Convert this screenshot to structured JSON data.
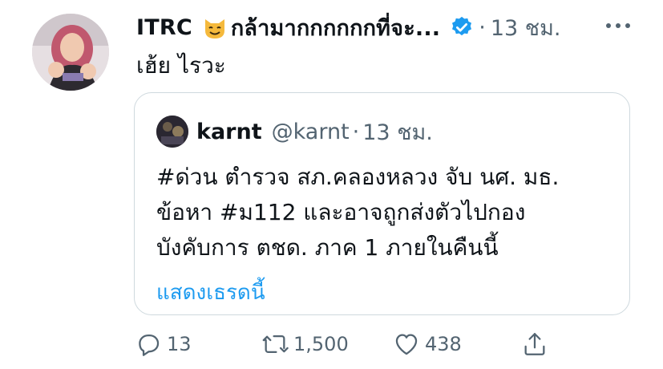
{
  "tweet": {
    "author_name": "ITRC",
    "author_name_suffix": "กล้ามากกกกกกที่จะ...",
    "timestamp": "13 ชม.",
    "dot": "·",
    "text": "เฮ้ย ไรวะ"
  },
  "quoted_tweet": {
    "author_name": "karnt",
    "handle": "@karnt",
    "timestamp": "13 ชม.",
    "dot": "·",
    "lines": [
      "#ด่วน ตำรวจ สภ.คลองหลวง จับ นศ. มธ.",
      "ข้อหา #ม112 และอาจถูกส่งตัวไปกอง",
      "บังคับการ ตชด. ภาค 1 ภายในคืนนี้"
    ],
    "show_thread_label": "แสดงเธรดนี้"
  },
  "actions": {
    "reply_count": "13",
    "retweet_count": "1,500",
    "like_count": "438"
  },
  "icons": {
    "cat": "cat-emoji-icon",
    "verified": "verified-badge-icon",
    "more": "more-options-icon",
    "reply": "reply-icon",
    "retweet": "retweet-icon",
    "like": "heart-icon",
    "share": "share-icon"
  },
  "colors": {
    "text": "#0f1419",
    "secondary": "#536471",
    "link": "#1d9bf0",
    "border": "#cfd9de"
  }
}
